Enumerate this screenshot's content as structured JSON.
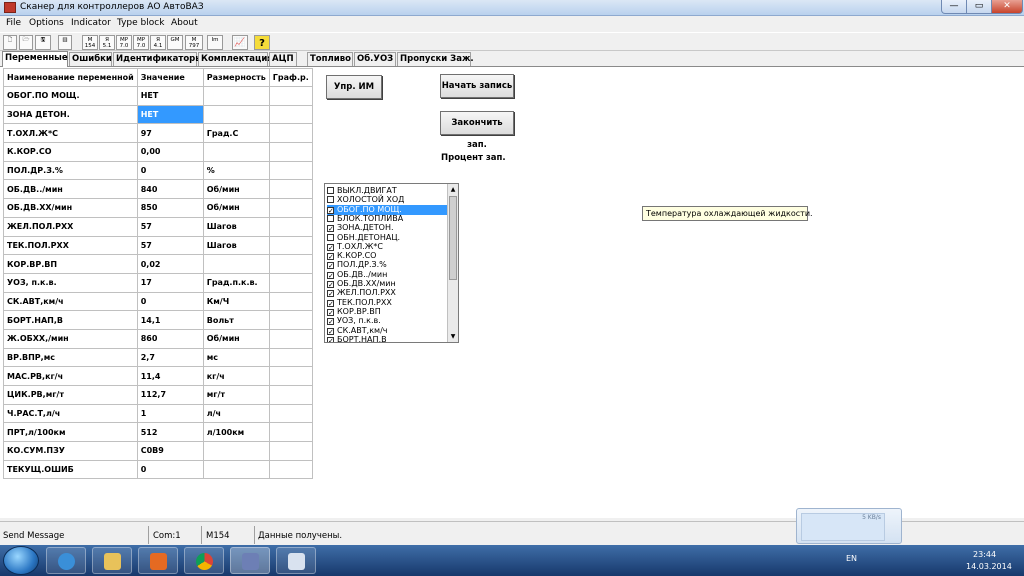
{
  "window": {
    "title": "Сканер для  контроллеров АО АвтоВАЗ",
    "min": "—",
    "max": "▭",
    "close": "✕"
  },
  "menu": [
    "File",
    "Options",
    "Indicator",
    "Type block",
    "About"
  ],
  "toolbar": {
    "buttons": [
      "🗋",
      "🗁",
      "🖫",
      "▥",
      "M 154",
      "Я 5.1",
      "MP 7.0",
      "MP 7.0",
      "Я 4.1",
      "GM",
      "M 797",
      "Im",
      "📈",
      "?"
    ]
  },
  "tabs": [
    "Переменные",
    "Ошибки",
    "Идентификаторы",
    "Комплектация",
    "АЦП",
    "Топливо",
    "Об.УОЗ",
    "Пропуски Заж."
  ],
  "table": {
    "headers": [
      "Наименование переменной",
      "Значение",
      "Размерность",
      "Граф.р."
    ],
    "rows": [
      [
        "ОБОГ.ПО МОЩ.",
        "НЕТ",
        ""
      ],
      [
        "ЗОНА ДЕТОН.",
        "НЕТ",
        ""
      ],
      [
        "Т.ОХЛ.Ж*С",
        "97",
        "Град.С"
      ],
      [
        "К.КОР.СО",
        "0,00",
        ""
      ],
      [
        "ПОЛ.ДР.З.%",
        "0",
        "%"
      ],
      [
        "ОБ.ДВ../мин",
        "840",
        "Об/мин"
      ],
      [
        "ОБ.ДВ.ХХ/мин",
        "850",
        "Об/мин"
      ],
      [
        "ЖЕЛ.ПОЛ.РХХ",
        "57",
        "Шагов"
      ],
      [
        "ТЕК.ПОЛ.РХХ",
        "57",
        "Шагов"
      ],
      [
        "КОР.ВР.ВП",
        "0,02",
        ""
      ],
      [
        "УОЗ, п.к.в.",
        "17",
        "Град.п.к.в."
      ],
      [
        "СК.АВТ,км/ч",
        "0",
        "Км/Ч"
      ],
      [
        "БОРТ.НАП,В",
        "14,1",
        "Вольт"
      ],
      [
        "Ж.ОБХХ,/мин",
        "860",
        "Об/мин"
      ],
      [
        "ВР.ВПР,мс",
        "2,7",
        "мс"
      ],
      [
        "МАС.РВ,кг/ч",
        "11,4",
        "кг/ч"
      ],
      [
        "ЦИК.РВ,мг/т",
        "112,7",
        "мг/т"
      ],
      [
        "Ч.РАС.Т,л/ч",
        "1",
        "л/ч"
      ],
      [
        "ПРТ,л/100км",
        "512",
        "л/100км"
      ],
      [
        "КО.СУМ.ПЗУ",
        "C0B9",
        ""
      ],
      [
        "ТЕКУЩ.ОШИБ",
        "0",
        ""
      ]
    ]
  },
  "controls": {
    "upr_im": "Упр. ИМ",
    "start_record": "Начать запись",
    "stop_record": "Закончить зап.",
    "percent_label": "Процент зап."
  },
  "checklist": {
    "items": [
      {
        "label": "ВЫКЛ.ДВИГАТ",
        "checked": false
      },
      {
        "label": "ХОЛОСТОЙ ХОД",
        "checked": false
      },
      {
        "label": "ОБОГ.ПО МОЩ.",
        "checked": true
      },
      {
        "label": "БЛОК.ТОПЛИВА",
        "checked": false
      },
      {
        "label": "ЗОНА.ДЕТОН.",
        "checked": true
      },
      {
        "label": "ОБН.ДЕТОНАЦ.",
        "checked": false
      },
      {
        "label": "Т.ОХЛ.Ж*С",
        "checked": true
      },
      {
        "label": "К.КОР.СО",
        "checked": true
      },
      {
        "label": "ПОЛ.ДР.З.%",
        "checked": true
      },
      {
        "label": "ОБ.ДВ../мин",
        "checked": true
      },
      {
        "label": "ОБ.ДВ.ХХ/мин",
        "checked": true
      },
      {
        "label": "ЖЕЛ.ПОЛ.РХХ",
        "checked": true
      },
      {
        "label": "ТЕК.ПОЛ.РХХ",
        "checked": true
      },
      {
        "label": "КОР.ВР.ВП",
        "checked": true
      },
      {
        "label": "УОЗ, п.к.в.",
        "checked": true
      },
      {
        "label": "СК.АВТ,км/ч",
        "checked": true
      },
      {
        "label": "БОРТ.НАП,В",
        "checked": true
      }
    ],
    "check_mark": "✓"
  },
  "tooltip": "Температура охлаждающей жидкости.",
  "status": {
    "message": "Send Message",
    "port": "Com:1",
    "block": "M154",
    "info": "Данные получены."
  },
  "netmeter": {
    "value": "5 KB/s"
  },
  "tray": {
    "lang": "EN",
    "time": "23:44",
    "date": "14.03.2014"
  },
  "colors": {
    "selection": "#3399ff",
    "tooltip_bg": "#ffffe1"
  }
}
